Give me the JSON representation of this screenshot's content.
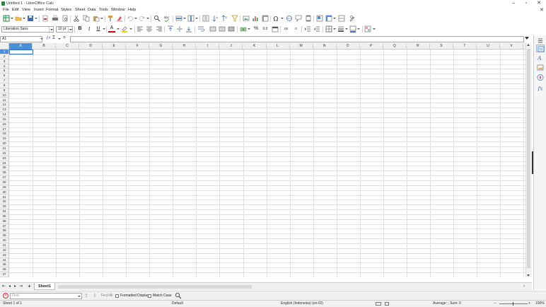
{
  "window": {
    "title": "Untitled 1 - LibreOffice Calc"
  },
  "menu": [
    "File",
    "Edit",
    "View",
    "Insert",
    "Format",
    "Styles",
    "Sheet",
    "Data",
    "Tools",
    "Window",
    "Help"
  ],
  "formatting": {
    "font_name": "Liberation Sans",
    "font_size": "10 pt"
  },
  "name_box": {
    "value": "A1"
  },
  "columns": [
    "A",
    "B",
    "C",
    "D",
    "E",
    "F",
    "G",
    "H",
    "I",
    "J",
    "K",
    "L",
    "M",
    "N",
    "O",
    "P",
    "Q",
    "R",
    "S",
    "T",
    "U",
    "V"
  ],
  "rows": [
    "1",
    "2",
    "3",
    "4",
    "5",
    "6",
    "7",
    "8",
    "9",
    "10",
    "11",
    "12",
    "13",
    "14",
    "15",
    "16",
    "17",
    "18",
    "19",
    "20",
    "21",
    "22",
    "23",
    "24",
    "25",
    "26",
    "27",
    "28",
    "29",
    "30",
    "31",
    "32",
    "33",
    "34",
    "35",
    "36",
    "37",
    "38",
    "39",
    "40",
    "41",
    "42",
    "43",
    "44",
    "45",
    "46",
    "47"
  ],
  "sheet_tabs": {
    "add_label": "+",
    "active": "Sheet1"
  },
  "find_bar": {
    "placeholder": "Find",
    "find_all": "Find All",
    "formatted_display": "Formatted Display",
    "match_case": "Match Case"
  },
  "status_bar": {
    "sheet": "Sheet 1 of 1",
    "page_style": "Default",
    "language": "English (Indonesia) (en-ID)",
    "summary": "Average: ; Sum: 0",
    "zoom": "100%"
  },
  "colors": {
    "accent": "#4a8fd8",
    "active_cell_border": "#2c6fc4",
    "app_icon": "#1e8a3e"
  }
}
